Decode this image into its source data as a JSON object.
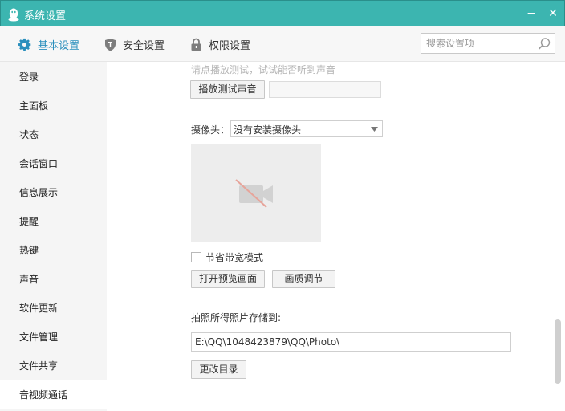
{
  "window": {
    "title": "系统设置",
    "minimize_glyph": "−",
    "close_glyph": "✕"
  },
  "toolbar": {
    "tabs": [
      {
        "label": "基本设置",
        "icon": "gear-icon",
        "active": true
      },
      {
        "label": "安全设置",
        "icon": "shield-icon",
        "active": false
      },
      {
        "label": "权限设置",
        "icon": "lock-icon",
        "active": false
      }
    ],
    "search_placeholder": "搜索设置项"
  },
  "sidebar": {
    "items": [
      {
        "label": "登录"
      },
      {
        "label": "主面板"
      },
      {
        "label": "状态"
      },
      {
        "label": "会话窗口"
      },
      {
        "label": "信息展示"
      },
      {
        "label": "提醒"
      },
      {
        "label": "热键"
      },
      {
        "label": "声音"
      },
      {
        "label": "软件更新"
      },
      {
        "label": "文件管理"
      },
      {
        "label": "文件共享"
      },
      {
        "label": "音视频通话",
        "active": true
      }
    ]
  },
  "audio": {
    "hint": "请点播放测试，试试能否听到声音",
    "play_test_button": "播放测试声音"
  },
  "camera": {
    "label": "摄像头：",
    "selected": "没有安装摄像头",
    "bandwidth_save_label": "节省带宽模式",
    "bandwidth_save_checked": false,
    "open_preview_button": "打开预览画面",
    "quality_button": "画质调节"
  },
  "photo": {
    "save_label": "拍照所得照片存储到:",
    "path": "E:\\QQ\\1048423879\\QQ\\Photo\\",
    "change_dir_button": "更改目录"
  },
  "colors": {
    "titlebar": "#3cb5b0",
    "accent": "#2a8fbd"
  }
}
